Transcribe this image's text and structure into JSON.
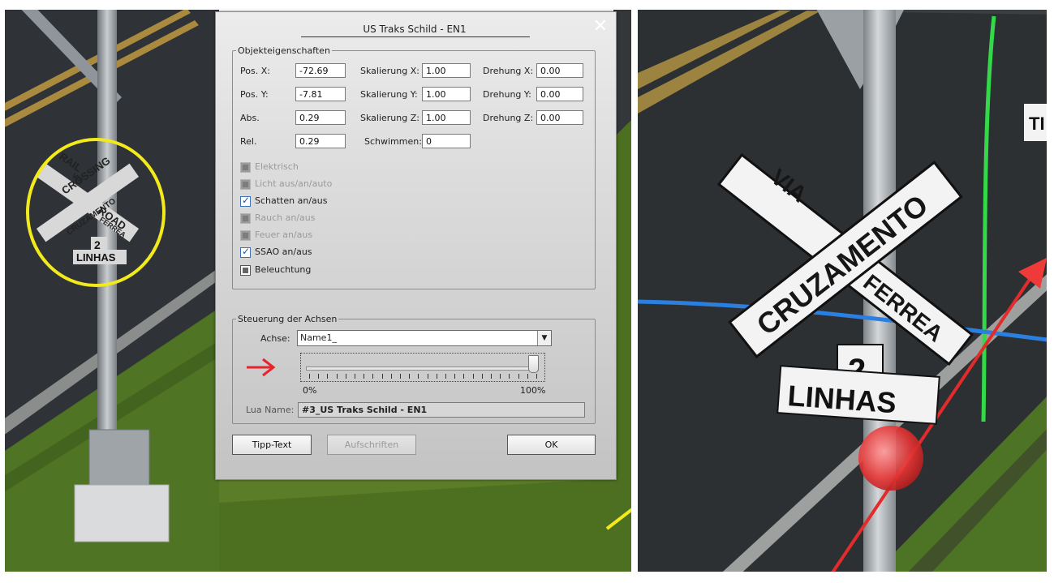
{
  "dialog": {
    "title": "US Traks Schild - EN1",
    "props_group": "Objekteigenschaften",
    "axis_group": "Steuerung der Achsen",
    "pos_x_label": "Pos. X:",
    "pos_x": "-72.69",
    "pos_y_label": "Pos. Y:",
    "pos_y": "-7.81",
    "abs_label": "Abs.",
    "abs": "0.29",
    "rel_label": "Rel.",
    "rel": "0.29",
    "scale_x_label": "Skalierung X:",
    "scale_x": "1.00",
    "scale_y_label": "Skalierung Y:",
    "scale_y": "1.00",
    "scale_z_label": "Skalierung Z:",
    "scale_z": "1.00",
    "swim_label": "Schwimmen:",
    "swim": "0",
    "rot_x_label": "Drehung X:",
    "rot_x": "0.00",
    "rot_y_label": "Drehung Y:",
    "rot_y": "0.00",
    "rot_z_label": "Drehung Z:",
    "rot_z": "0.00",
    "checkboxes": [
      {
        "label": "Elektrisch",
        "state": "disabled"
      },
      {
        "label": "Licht aus/an/auto",
        "state": "disabled"
      },
      {
        "label": "Schatten an/aus",
        "state": "checked"
      },
      {
        "label": "Rauch an/aus",
        "state": "disabled"
      },
      {
        "label": "Feuer an/aus",
        "state": "disabled"
      },
      {
        "label": "SSAO an/aus",
        "state": "checked"
      },
      {
        "label": "Beleuchtung",
        "state": "unchecked"
      }
    ],
    "axis_label": "Achse:",
    "axis_value": "Name1_",
    "slider_value": 1.0,
    "slider_min": "0%",
    "slider_max": "100%",
    "lua_label": "Lua Name:",
    "lua_value": "#3_US Traks Schild - EN1",
    "tipp_button": "Tipp-Text",
    "aufschriften_button": "Aufschriften",
    "ok_button": "OK"
  },
  "scene": {
    "sign_left": {
      "rail": "RAIL",
      "road": "ROAD",
      "crossing": "CROSSING",
      "via": "VIA",
      "cruzamento": "CRUZAMENTO",
      "ferrea": "FERREA",
      "tracks": "2",
      "linhas": "LINHAS"
    },
    "sign_right": {
      "via": "VIA",
      "cruzamento": "CRUZAMENTO",
      "ferrea": "FERREA",
      "tracks": "2",
      "linhas": "LINHAS",
      "edge": "TI"
    },
    "highlight_color": "#f2ea1a",
    "arrow_color": "#e8232a",
    "axis_colors": {
      "x": "#e42b2b",
      "y": "#25d83a",
      "z": "#2b7fe0"
    }
  }
}
